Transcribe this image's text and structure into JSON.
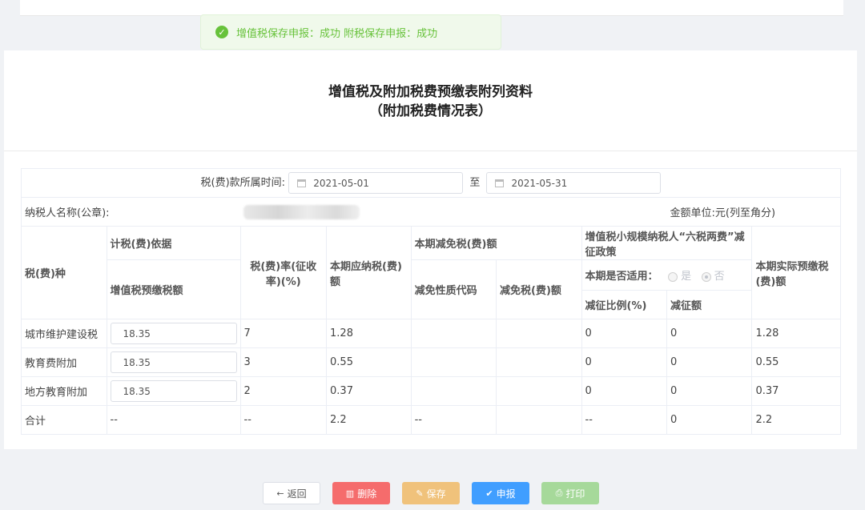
{
  "toast": {
    "message": "增值税保存申报：成功 附税保存申报：成功"
  },
  "title": {
    "line1": "增值税及附加税费预缴表附列资料",
    "line2": "（附加税费情况表）"
  },
  "period": {
    "label": "税(费)款所属时间:",
    "start": "2021-05-01",
    "separator": "至",
    "end": "2021-05-31"
  },
  "taxpayer": {
    "label": "纳税人名称(公章):",
    "unit": "金额单位:元(列至角分)"
  },
  "headers": {
    "tax_type": "税(费)种",
    "basis": "计税(费)依据",
    "vat_prepaid": "增值税预缴税额",
    "rate": "税(费)率(征收率)(%)",
    "payable": "本期应纳税(费)额",
    "reduction": "本期减免税(费)额",
    "reduction_code": "减免性质代码",
    "reduction_amount": "减免税(费)额",
    "policy": "增值税小规模纳税人“六税两费”减征政策",
    "applicable": "本期是否适用：",
    "yes": "是",
    "no": "否",
    "ratio": "减征比例(%)",
    "reduce_amt": "减征额",
    "actual": "本期实际预缴税(费)额"
  },
  "rows": [
    {
      "name": "城市维护建设税",
      "basis": "18.35",
      "rate": "7",
      "payable": "1.28",
      "code": "",
      "reduction": "",
      "ratio": "0",
      "reduce": "0",
      "actual": "1.28"
    },
    {
      "name": "教育费附加",
      "basis": "18.35",
      "rate": "3",
      "payable": "0.55",
      "code": "",
      "reduction": "",
      "ratio": "0",
      "reduce": "0",
      "actual": "0.55"
    },
    {
      "name": "地方教育附加",
      "basis": "18.35",
      "rate": "2",
      "payable": "0.37",
      "code": "",
      "reduction": "",
      "ratio": "0",
      "reduce": "0",
      "actual": "0.37"
    }
  ],
  "total": {
    "name": "合计",
    "basis": "--",
    "rate": "--",
    "payable": "2.2",
    "code": "--",
    "reduction": "",
    "ratio": "--",
    "reduce": "0",
    "actual": "2.2"
  },
  "buttons": {
    "back": "返回",
    "delete": "删除",
    "save": "保存",
    "submit": "申报",
    "print": "打印"
  },
  "colors": {
    "success": "#67c23a",
    "danger": "#f56c6c",
    "warning": "#f0c27b",
    "primary": "#409eff",
    "print": "#a6d99a"
  }
}
